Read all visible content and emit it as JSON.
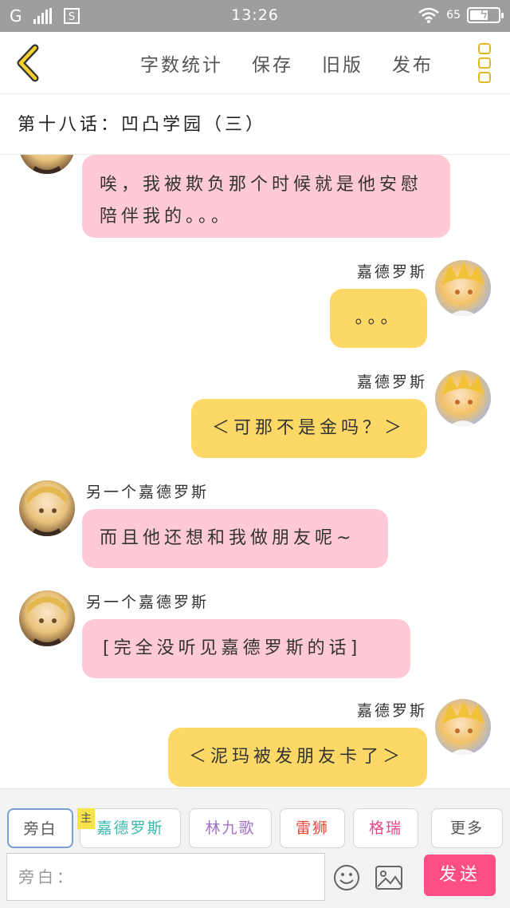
{
  "status_bar": {
    "network": "G",
    "sim_icon": "sim-icon",
    "time": "13:26",
    "battery_percent": "65",
    "battery_level": 0.65
  },
  "top_bar": {
    "actions": [
      "字数统计",
      "保存",
      "旧版",
      "发布"
    ]
  },
  "chapter": {
    "title": "第十八话：凹凸学园（三）"
  },
  "messages": [
    {
      "side": "left",
      "sender": "",
      "text": "唉，我被欺负那个时候就是他安慰陪伴我的。。。",
      "color": "#ffc9d6"
    },
    {
      "side": "right",
      "sender": "嘉德罗斯",
      "text": "。。。",
      "color": "#fdd866"
    },
    {
      "side": "right",
      "sender": "嘉德罗斯",
      "text": "＜可那不是金吗？＞",
      "color": "#fdd866"
    },
    {
      "side": "left",
      "sender": "另一个嘉德罗斯",
      "text": "而且他还想和我做朋友呢~",
      "color": "#ffc9d6"
    },
    {
      "side": "left",
      "sender": "另一个嘉德罗斯",
      "text": "[完全没听见嘉德罗斯的话]",
      "color": "#ffc9d6"
    },
    {
      "side": "right",
      "sender": "嘉德罗斯",
      "text": "＜泥玛被发朋友卡了＞",
      "color": "#fdd866"
    }
  ],
  "roles": [
    {
      "label": "旁白",
      "color": "#555555",
      "active": true
    },
    {
      "label": "嘉德罗斯",
      "color": "#3bb9b0",
      "badge": "主"
    },
    {
      "label": "林九歌",
      "color": "#a070c8"
    },
    {
      "label": "雷狮",
      "color": "#e04a3a"
    },
    {
      "label": "格瑞",
      "color": "#e8478a"
    },
    {
      "label": "更多",
      "color": "#555555"
    }
  ],
  "input": {
    "placeholder": "旁白："
  },
  "send_label": "发送"
}
